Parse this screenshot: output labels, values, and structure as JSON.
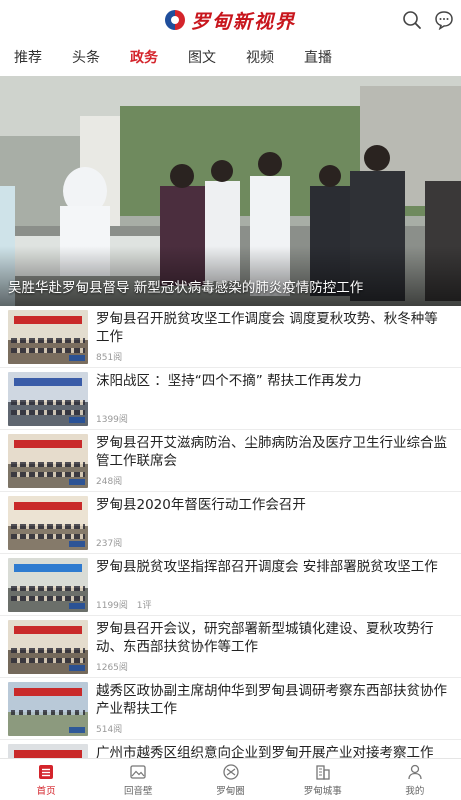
{
  "header": {
    "app_title": "罗甸新视界",
    "search_icon": "search-icon",
    "chat_icon": "chat-icon"
  },
  "tabs": [
    {
      "label": "推荐",
      "active": false
    },
    {
      "label": "头条",
      "active": false
    },
    {
      "label": "政务",
      "active": true
    },
    {
      "label": "图文",
      "active": false
    },
    {
      "label": "视频",
      "active": false
    },
    {
      "label": "直播",
      "active": false
    }
  ],
  "hero": {
    "caption": "吴胜华赴罗甸县督导 新型冠状病毒感染的肺炎疫情防控工作"
  },
  "news": [
    {
      "title": "罗甸县召开脱贫攻坚工作调度会 调度夏秋攻势、秋冬种等工作",
      "views": "851阅",
      "comments": ""
    },
    {
      "title": "沫阳战区 ：坚持“四个不摘” 帮扶工作再发力",
      "views": "1399阅",
      "comments": ""
    },
    {
      "title": "罗甸县召开艾滋病防治、尘肺病防治及医疗卫生行业综合监管工作联席会",
      "views": "248阅",
      "comments": ""
    },
    {
      "title": "罗甸县2020年督医行动工作会召开",
      "views": "237阅",
      "comments": ""
    },
    {
      "title": "罗甸县脱贫攻坚指挥部召开调度会 安排部署脱贫攻坚工作",
      "views": "1199阅",
      "comments": "1评"
    },
    {
      "title": "罗甸县召开会议，研究部署新型城镇化建设、夏秋攻势行动、东西部扶贫协作等工作",
      "views": "1265阅",
      "comments": ""
    },
    {
      "title": "越秀区政协副主席胡仲华到罗甸县调研考察东西部扶贫协作产业帮扶工作",
      "views": "514阅",
      "comments": ""
    },
    {
      "title": "广州市越秀区组织意向企业到罗甸开展产业对接考察工作",
      "views": "",
      "comments": ""
    }
  ],
  "bottom_nav": [
    {
      "label": "首页",
      "icon": "home-icon",
      "active": true
    },
    {
      "label": "回音壁",
      "icon": "picture-icon",
      "active": false
    },
    {
      "label": "罗甸圈",
      "icon": "circle-icon",
      "active": false
    },
    {
      "label": "罗甸城事",
      "icon": "building-icon",
      "active": false
    },
    {
      "label": "我的",
      "icon": "user-icon",
      "active": false
    }
  ],
  "colors": {
    "accent": "#d4242b",
    "brand_blue": "#1f4e9c"
  }
}
